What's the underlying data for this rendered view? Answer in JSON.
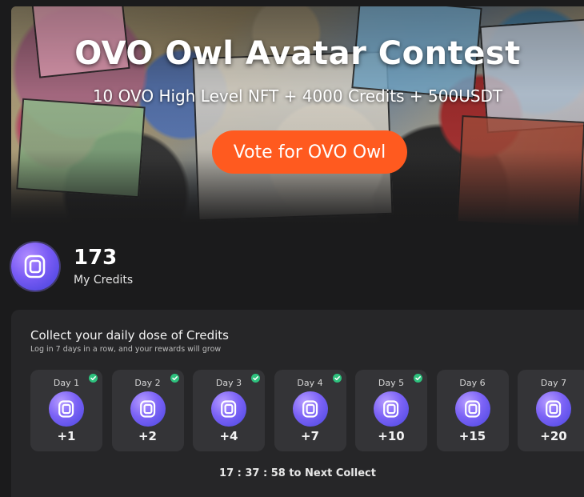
{
  "banner": {
    "title": "OVO Owl Avatar Contest",
    "subtitle": "10 OVO High Level NFT + 4000 Credits + 500USDT",
    "vote_label": "Vote for OVO Owl"
  },
  "credits": {
    "value": "173",
    "label": "My Credits",
    "icon": "credits-coin-icon"
  },
  "daily": {
    "title": "Collect your daily dose of Credits",
    "subtitle": "Log in 7 days in a row, and your rewards will grow",
    "days": [
      {
        "label": "Day 1",
        "reward": "+1",
        "collected": true
      },
      {
        "label": "Day 2",
        "reward": "+2",
        "collected": true
      },
      {
        "label": "Day 3",
        "reward": "+4",
        "collected": true
      },
      {
        "label": "Day 4",
        "reward": "+7",
        "collected": true
      },
      {
        "label": "Day 5",
        "reward": "+10",
        "collected": true
      },
      {
        "label": "Day 6",
        "reward": "+15",
        "collected": false
      },
      {
        "label": "Day 7",
        "reward": "+20",
        "collected": false
      }
    ],
    "next_collect": "17 : 37 : 58 to Next Collect"
  },
  "colors": {
    "accent": "#ff5a1f",
    "check": "#2ec27e",
    "coin": "#7a5cf5"
  }
}
